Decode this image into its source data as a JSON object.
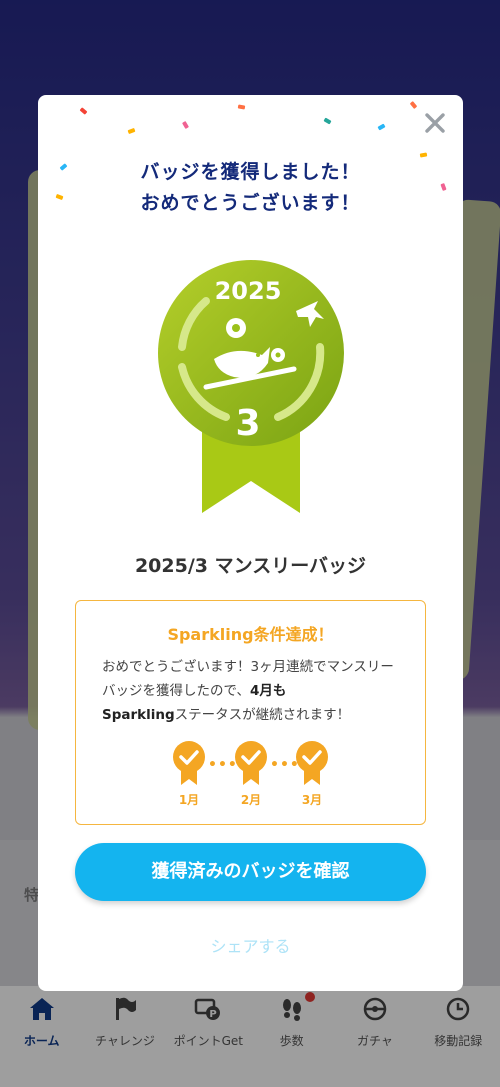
{
  "modal": {
    "title_line1": "バッジを獲得しました！",
    "title_line2": "おめでとうございます！",
    "medal": {
      "year": "2025",
      "month": "3",
      "color": "#9bc11a"
    },
    "badge_name": "2025/3 マンスリーバッジ",
    "sparkling": {
      "title": "Sparkling条件達成！",
      "text_part1": "おめでとうございます！3ヶ月連続でマンスリーバッジを獲得したので、",
      "text_bold1": "4月も",
      "text_bold2": "Sparkling",
      "text_part2": "ステータスが継続されます！",
      "months": [
        "1月",
        "2月",
        "3月"
      ]
    },
    "confirm_button": "獲得済みのバッジを確認",
    "share_link": "シェアする"
  },
  "background": {
    "section_label": "特"
  },
  "tabbar": {
    "items": [
      {
        "label": "ホーム",
        "icon": "home-icon",
        "active": true
      },
      {
        "label": "チャレンジ",
        "icon": "flag-icon"
      },
      {
        "label": "ポイントGet",
        "icon": "point-card-icon"
      },
      {
        "label": "歩数",
        "icon": "footprints-icon",
        "badge": true
      },
      {
        "label": "ガチャ",
        "icon": "gacha-icon"
      },
      {
        "label": "移動記録",
        "icon": "clock-icon"
      }
    ]
  }
}
